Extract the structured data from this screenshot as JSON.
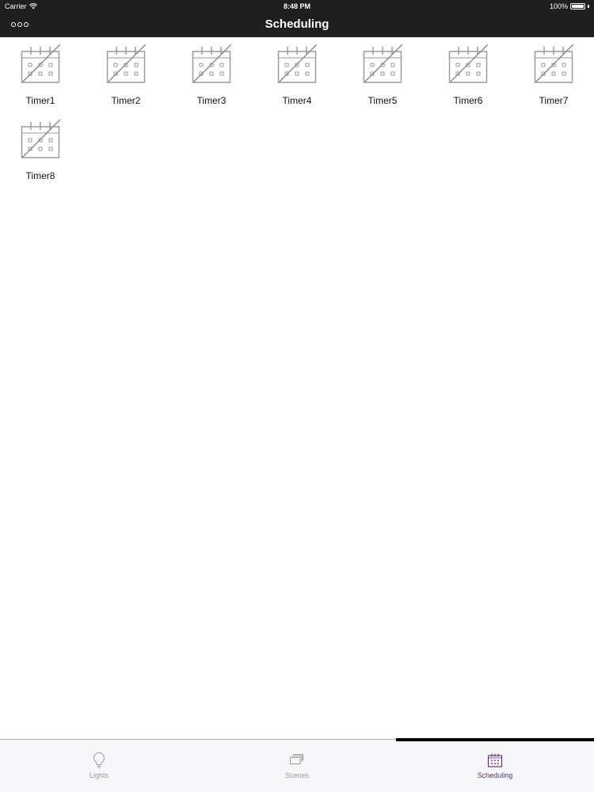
{
  "status_bar": {
    "carrier": "Carrier",
    "time": "8:48 PM",
    "battery": "100%"
  },
  "nav": {
    "title": "Scheduling",
    "more_icon": "ellipsis-circles-icon"
  },
  "timers": [
    {
      "label": "Timer1",
      "icon": "calendar-disabled-icon"
    },
    {
      "label": "Timer2",
      "icon": "calendar-disabled-icon"
    },
    {
      "label": "Timer3",
      "icon": "calendar-disabled-icon"
    },
    {
      "label": "Timer4",
      "icon": "calendar-disabled-icon"
    },
    {
      "label": "Timer5",
      "icon": "calendar-disabled-icon"
    },
    {
      "label": "Timer6",
      "icon": "calendar-disabled-icon"
    },
    {
      "label": "Timer7",
      "icon": "calendar-disabled-icon"
    },
    {
      "label": "Timer8",
      "icon": "calendar-disabled-icon"
    }
  ],
  "tabs": [
    {
      "label": "Lights",
      "icon": "lightbulb-icon",
      "active": false
    },
    {
      "label": "Scenes",
      "icon": "stacked-layers-icon",
      "active": false
    },
    {
      "label": "Scheduling",
      "icon": "calendar-icon",
      "active": true
    }
  ],
  "colors": {
    "nav_background": "#1f1f1f",
    "active_tab": "#5d2a78",
    "inactive_tab": "#9a9a9a",
    "icon_gray": "#9a9a9a"
  }
}
